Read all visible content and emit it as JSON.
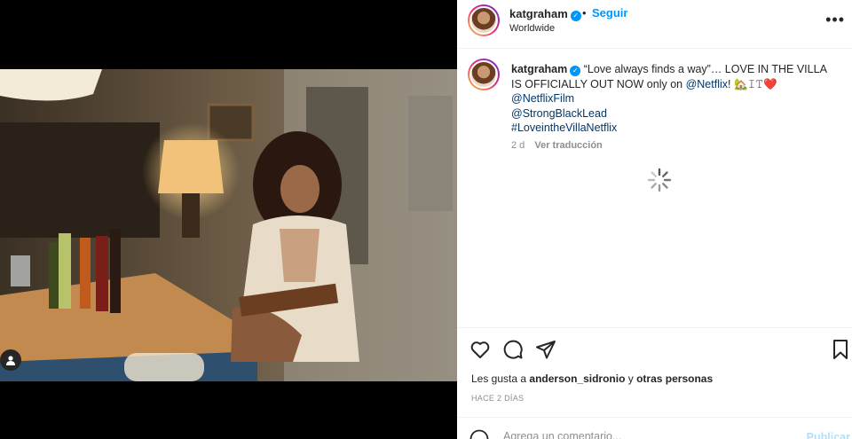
{
  "post": {
    "username": "katgraham",
    "location": "Worldwide",
    "follow_label": "Seguir",
    "separator": "•",
    "more_icon": "more-horizontal-icon",
    "colors": {
      "accent": "#0095f6",
      "link": "#00376b",
      "muted": "#8e8e8e"
    }
  },
  "caption": {
    "username": "katgraham",
    "text": "“Love always finds a way”… LOVE IN THE VILLA IS OFFICIALLY OUT NOW only on ",
    "mention_inline": "@Netflix",
    "text_end": "! 🏡𝙸𝚃❤️",
    "lines": [
      "@NetflixFilm",
      "@StrongBlackLead",
      "#LoveintheVillaNetflix"
    ],
    "age": "2 d",
    "translate_label": "Ver traducción"
  },
  "engagement": {
    "likes_prefix": "Les gusta a ",
    "liked_by": "anderson_sidronio",
    "likes_mid": " y ",
    "others": "otras personas",
    "timestamp": "HACE 2 DÍAS"
  },
  "comment_box": {
    "placeholder": "Agrega un comentario...",
    "publish_label": "Publicar"
  }
}
